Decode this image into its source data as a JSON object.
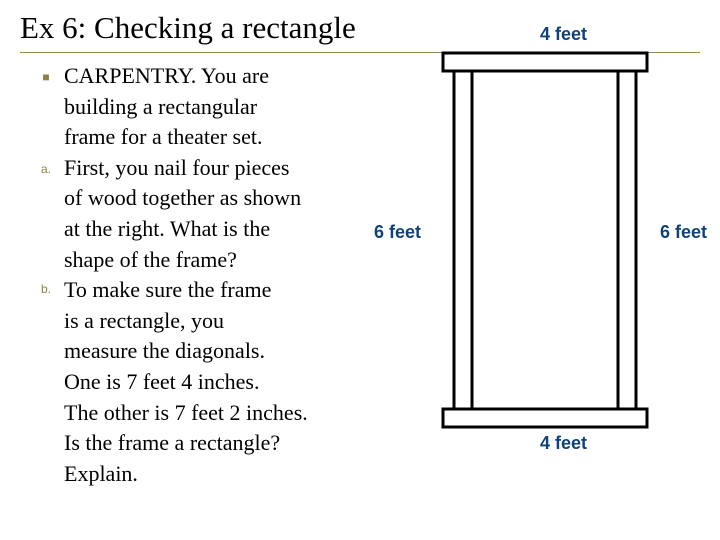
{
  "title": "Ex 6:  Checking a rectangle",
  "items": {
    "bullet": "■",
    "a_marker": "a.",
    "b_marker": "b.",
    "intro_l1": "CARPENTRY.  You are",
    "intro_l2": "building a rectangular",
    "intro_l3": "frame for a theater set.",
    "a_l1": "First, you nail four pieces",
    "a_l2": "of wood together as shown",
    "a_l3": "at the right.  What is the",
    "a_l4": "shape of the frame?",
    "b_l1": "To make sure the frame",
    "b_l2": "is a rectangle, you",
    "b_l3": "measure the diagonals.",
    "b_l4": "One is 7 feet 4 inches.",
    "b_l5": "The other is 7 feet 2 inches.",
    "b_l6": "Is the frame a rectangle?",
    "b_l7": "Explain."
  },
  "figure": {
    "label_top": "4 feet",
    "label_left": "6 feet",
    "label_right": "6 feet",
    "label_bottom": "4 feet"
  }
}
